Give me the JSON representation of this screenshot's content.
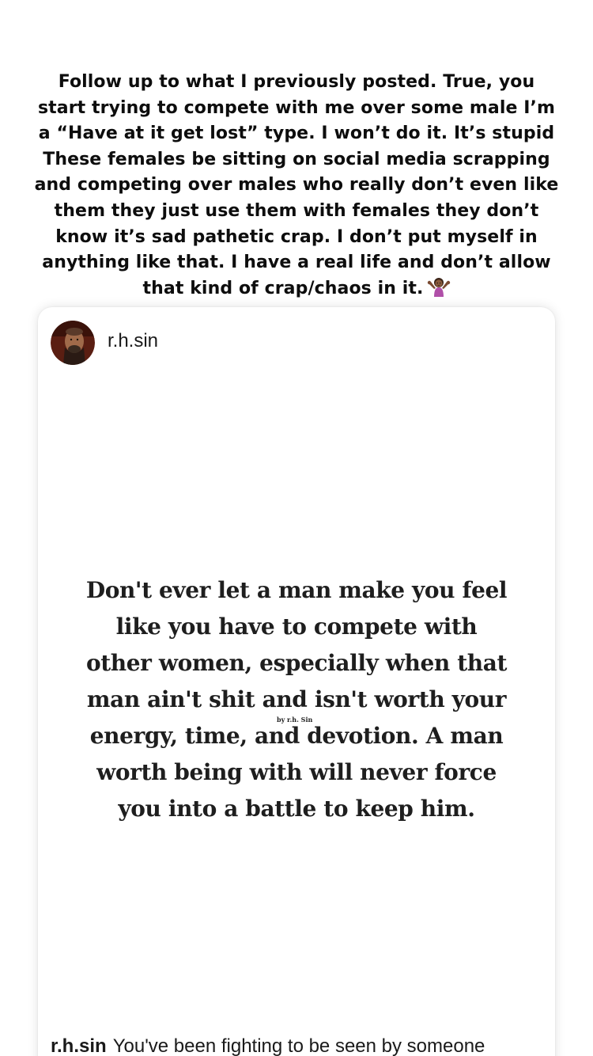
{
  "story": {
    "caption_lines": [
      "Follow up to what I previously posted. True, you",
      "start trying to compete with me over some male I’m",
      "a  “Have at it get lost” type. I won’t do it. It’s stupid",
      "These females be sitting on social media scrapping",
      "and competing over males who really don’t even like",
      "them they just use them with females they don’t",
      "know it’s sad pathetic crap. I don’t put myself in",
      "anything like that. I have a real life and don’t allow",
      "that kind of crap/chaos in it."
    ],
    "emoji": "woman-shrugging-emoji"
  },
  "post": {
    "username": "r.h.sin",
    "avatar_icon": "profile-photo-avatar",
    "quote_lines": [
      "Don't ever let a man make you feel",
      "like you have to compete with",
      "other women, especially when that",
      "man ain't shit and isn't worth your",
      "energy, time, and devotion. A man",
      "worth being with will never force",
      "you into a battle to keep him."
    ],
    "byline": "by r.h. Sin",
    "caption_user": "r.h.sin",
    "caption_text": "You've been fighting to be seen by someone"
  },
  "colors": {
    "background": "#ffffff",
    "text": "#111111",
    "card_shadow": "#e6e6e6"
  }
}
